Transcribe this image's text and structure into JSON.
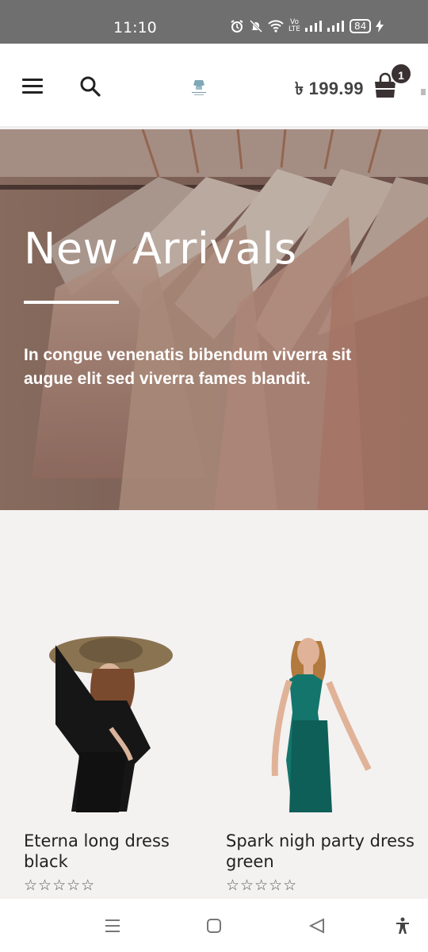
{
  "status": {
    "time": "11:10",
    "volte_top": "Vo",
    "volte_bottom": "LTE",
    "battery": "84"
  },
  "header": {
    "cart_total": "৳ 199.99",
    "cart_count": "1"
  },
  "hero": {
    "title": "New Arrivals",
    "text": "In congue venenatis bibendum viverra sit augue elit sed viverra fames blandit."
  },
  "products": [
    {
      "title": "Eterna long dress black",
      "rating": 0,
      "stars": "☆☆☆☆☆"
    },
    {
      "title": "Spark nigh party dress green",
      "rating": 0,
      "stars": "☆☆☆☆☆"
    }
  ],
  "icons": {
    "menu": "hamburger-icon",
    "search": "search-icon",
    "cart": "shopping-bag-icon",
    "nav_recent": "recent-apps-icon",
    "nav_home": "home-icon",
    "nav_back": "back-icon",
    "nav_accessibility": "accessibility-icon"
  },
  "colors": {
    "status_bar": "#6f6f6f",
    "badge": "#3a3133",
    "page_bg": "#f4f1f1"
  }
}
